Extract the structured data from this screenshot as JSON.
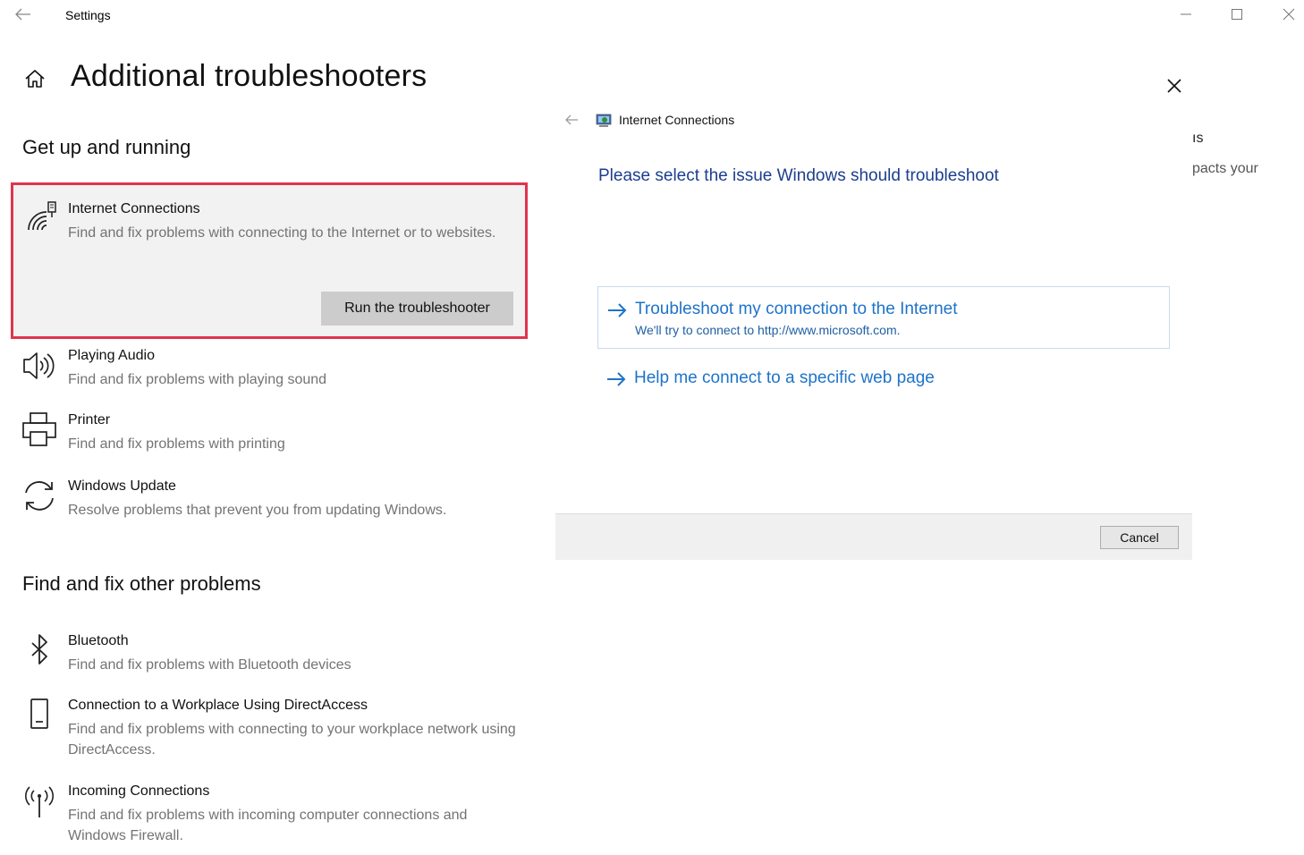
{
  "window": {
    "title": "Settings"
  },
  "page": {
    "title": "Additional troubleshooters"
  },
  "sections": {
    "get_up": "Get up and running",
    "find_fix": "Find and fix other problems"
  },
  "items": [
    {
      "name": "Internet Connections",
      "desc": "Find and fix problems with connecting to the Internet or to websites.",
      "icon": "wifi-icon"
    },
    {
      "name": "Playing Audio",
      "desc": "Find and fix problems with playing sound",
      "icon": "speaker-icon"
    },
    {
      "name": "Printer",
      "desc": "Find and fix problems with printing",
      "icon": "printer-icon"
    },
    {
      "name": "Windows Update",
      "desc": "Resolve problems that prevent you from updating Windows.",
      "icon": "sync-icon"
    },
    {
      "name": "Bluetooth",
      "desc": "Find and fix problems with Bluetooth devices",
      "icon": "bluetooth-icon"
    },
    {
      "name": "Connection to a Workplace Using DirectAccess",
      "desc": "Find and fix problems with connecting to your workplace network using DirectAccess.",
      "icon": "phone-icon"
    },
    {
      "name": "Incoming Connections",
      "desc": "Find and fix problems with incoming computer connections and Windows Firewall.",
      "icon": "antenna-icon"
    }
  ],
  "run_button": "Run the troubleshooter",
  "dialog": {
    "app_title": "Internet Connections",
    "heading": "Please select the issue Windows should troubleshoot",
    "options": [
      {
        "label": "Troubleshoot my connection to the Internet",
        "sub": "We'll try to connect to http://www.microsoft.com."
      },
      {
        "label": "Help me connect to a specific web page"
      }
    ],
    "cancel": "Cancel"
  },
  "background_fragments": [
    "ıs",
    "pacts your"
  ],
  "colors": {
    "accent": "#1e73c9",
    "heading_blue": "#1b3e8f",
    "highlight_border": "#e0344d"
  }
}
